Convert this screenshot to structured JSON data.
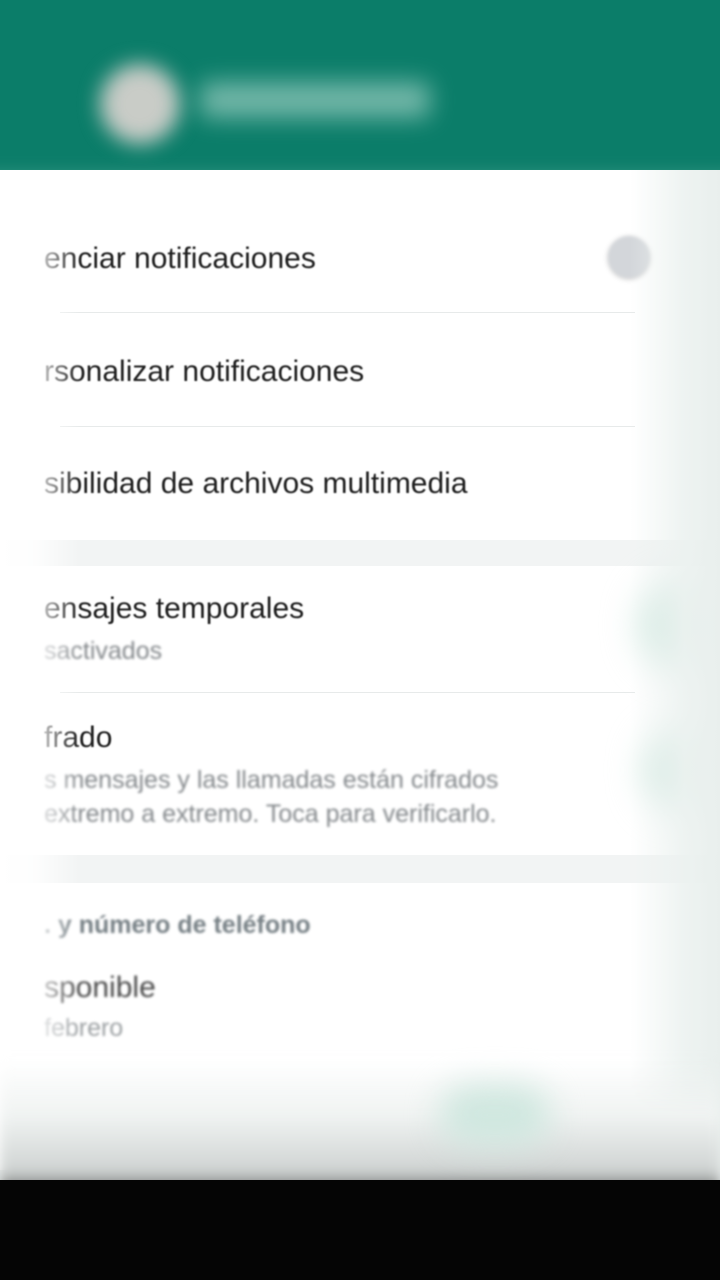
{
  "header": {
    "contact_name": "",
    "accent_color": "#0b7d69"
  },
  "settings": {
    "mute_label": "enciar notificaciones",
    "custom_notifications_label": "rsonalizar notificaciones",
    "media_visibility_label": "sibilidad de archivos multimedia",
    "disappearing_messages_label": "ensajes temporales",
    "disappearing_messages_status": "sactivados",
    "encryption_label": "frado",
    "encryption_desc_line1": "s mensajes y las llamadas están cifrados",
    "encryption_desc_line2": "extremo a extremo. Toca para verificarlo."
  },
  "info_section": {
    "header": ". y número de teléfono",
    "status_label": "sponible",
    "status_date": "febrero"
  },
  "icons": {
    "mute_toggle": "toggle-switch-icon",
    "avatar": "avatar-icon"
  }
}
